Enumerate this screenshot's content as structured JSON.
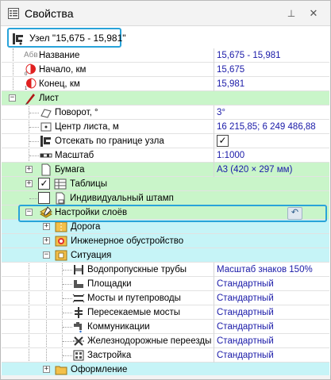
{
  "window": {
    "title": "Свойства",
    "pin_icon": "pin-icon",
    "close_icon": "close-icon"
  },
  "node": {
    "label": "Узел \"15,675 - 15,981\""
  },
  "rows": {
    "name": {
      "label": "Название",
      "value": "15,675 - 15,981",
      "badge": "Абв"
    },
    "start": {
      "label": "Начало, км",
      "value": "15,675"
    },
    "end": {
      "label": "Конец, км",
      "value": "15,981"
    },
    "sheet": {
      "label": "Лист"
    },
    "rotation": {
      "label": "Поворот, °",
      "value": "3°"
    },
    "center": {
      "label": "Центр листа, м",
      "value": "16 215,85; 6 249 486,88"
    },
    "clip": {
      "label": "Отсекать по границе узла",
      "checked": true
    },
    "scale": {
      "label": "Масштаб",
      "value": "1:1000"
    },
    "paper": {
      "label": "Бумага",
      "value": "A3 (420 × 297 мм)"
    },
    "tables": {
      "label": "Таблицы",
      "checked": true
    },
    "stamp": {
      "label": "Индивидуальный штамп",
      "checked": false
    },
    "layers": {
      "label": "Настройки слоёв"
    },
    "road": {
      "label": "Дорога"
    },
    "engineering": {
      "label": "Инженерное обустройство"
    },
    "situation": {
      "label": "Ситуация"
    },
    "culverts": {
      "label": "Водопропускные трубы",
      "value": "Масштаб знаков 150%"
    },
    "areas": {
      "label": "Площадки",
      "value": "Стандартный"
    },
    "bridges": {
      "label": "Мосты и путепроводы",
      "value": "Стандартный"
    },
    "crossed_bridges": {
      "label": "Пересекаемые мосты",
      "value": "Стандартный"
    },
    "utilities": {
      "label": "Коммуникации",
      "value": "Стандартный"
    },
    "rail": {
      "label": "Железнодорожные переезды",
      "value": "Стандартный"
    },
    "buildings": {
      "label": "Застройка",
      "value": "Стандартный"
    },
    "design": {
      "label": "Оформление"
    }
  },
  "colors": {
    "accent": "#29a3d9",
    "group_green": "#c9f5c9",
    "group_cyan": "#c6f4f7",
    "value_text": "#1a1aa8"
  }
}
